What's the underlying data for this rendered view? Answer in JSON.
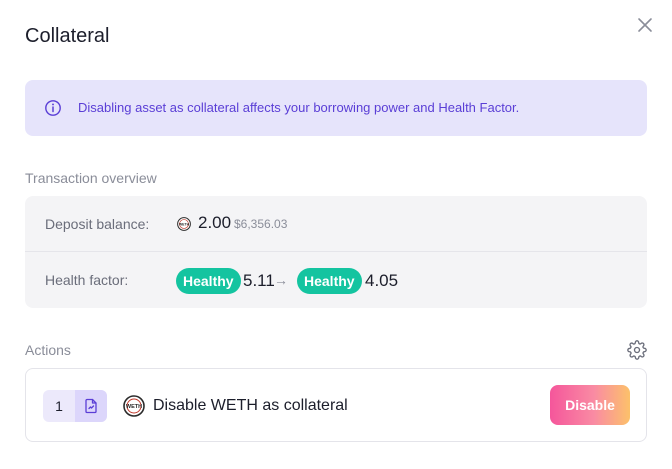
{
  "modal": {
    "title": "Collateral",
    "close_icon": "close-icon"
  },
  "alert": {
    "icon": "info-icon",
    "text": "Disabling asset as collateral affects your borrowing power and Health Factor."
  },
  "overview": {
    "label": "Transaction overview",
    "deposit": {
      "key": "Deposit balance:",
      "token_icon": "weth-token-icon",
      "amount": "2.00",
      "usd": "$6,356.03"
    },
    "health": {
      "key": "Health factor:",
      "badge_before": "Healthy",
      "value_before": "5.11",
      "arrow": "→",
      "badge_after": "Healthy",
      "value_after": "4.05"
    }
  },
  "actions": {
    "label": "Actions",
    "settings_icon": "gear-icon",
    "step": {
      "number": "1",
      "step_icon": "document-sign-icon",
      "token_icon": "weth-token-icon",
      "text": "Disable WETH as collateral",
      "button_label": "Disable"
    }
  },
  "colors": {
    "alert_bg": "#e6e4fb",
    "alert_text": "#5a3ed6",
    "healthy_badge": "#14c4a0",
    "button_gradient_start": "#f5569b",
    "button_gradient_end": "#fcc16a"
  }
}
